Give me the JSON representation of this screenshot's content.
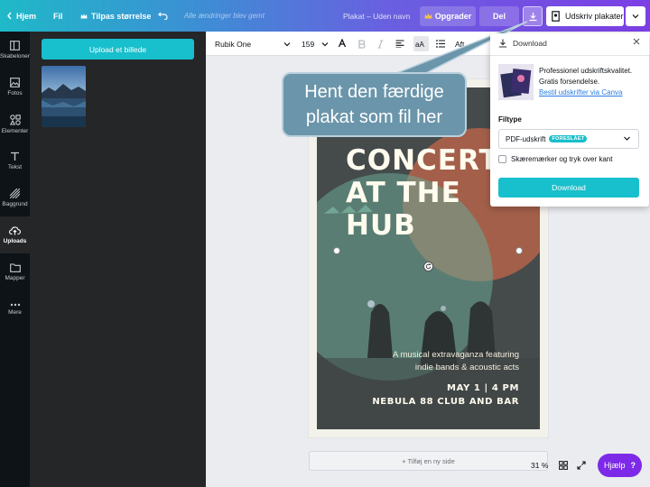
{
  "topbar": {
    "home_label": "Hjem",
    "file_label": "Fil",
    "resize_label": "Tilpas størrelse",
    "saved_status": "Alle ændringer blev gemt",
    "doc_title": "Plakat – Uden navn",
    "upgrade_label": "Opgrader",
    "share_label": "Del",
    "print_label": "Udskriv plakater"
  },
  "rail": {
    "items": [
      {
        "label": "Skabeloner",
        "icon": "templates-icon"
      },
      {
        "label": "Fotos",
        "icon": "photos-icon"
      },
      {
        "label": "Elementer",
        "icon": "elements-icon"
      },
      {
        "label": "Tekst",
        "icon": "text-icon"
      },
      {
        "label": "Baggrund",
        "icon": "background-icon"
      },
      {
        "label": "Uploads",
        "icon": "upload-icon"
      },
      {
        "label": "Mapper",
        "icon": "folder-icon"
      },
      {
        "label": "Mere",
        "icon": "more-icon"
      }
    ]
  },
  "panel": {
    "upload_button": "Upload et billede"
  },
  "toolbar": {
    "font": "Rubik One",
    "size": "159",
    "partial_label": "Aft"
  },
  "poster": {
    "headline": [
      "CONCERT",
      "AT THE",
      "HUB"
    ],
    "description": [
      "A musical extravaganza featuring",
      "indie bands & acoustic acts"
    ],
    "date": "MAY 1 | 4 PM",
    "venue": "NEBULA 88 CLUB AND BAR",
    "colors": {
      "background": "#f3f2ea",
      "accent_green": "#7fb6a4",
      "accent_orange": "#d97b5c",
      "text": "#fffbee"
    }
  },
  "canvas": {
    "add_page": "+ Tilføj en ny side",
    "zoom": "31 %",
    "help": "Hjælp",
    "help_symbol": "?"
  },
  "download_panel": {
    "title": "Download",
    "promo_text_1": "Professionel udskriftskvalitet.",
    "promo_text_2": "Gratis forsendelse.",
    "promo_link": "Bestil udskrifter via Canva",
    "filetype_label": "Filtype",
    "filetype_value": "PDF-udskrift",
    "filetype_badge": "FORESLÅET",
    "checkbox_label": "Skæremærker og tryk over kant",
    "download_button": "Download"
  },
  "callout": {
    "text": "Hent den færdige\nplakat som fil her"
  }
}
